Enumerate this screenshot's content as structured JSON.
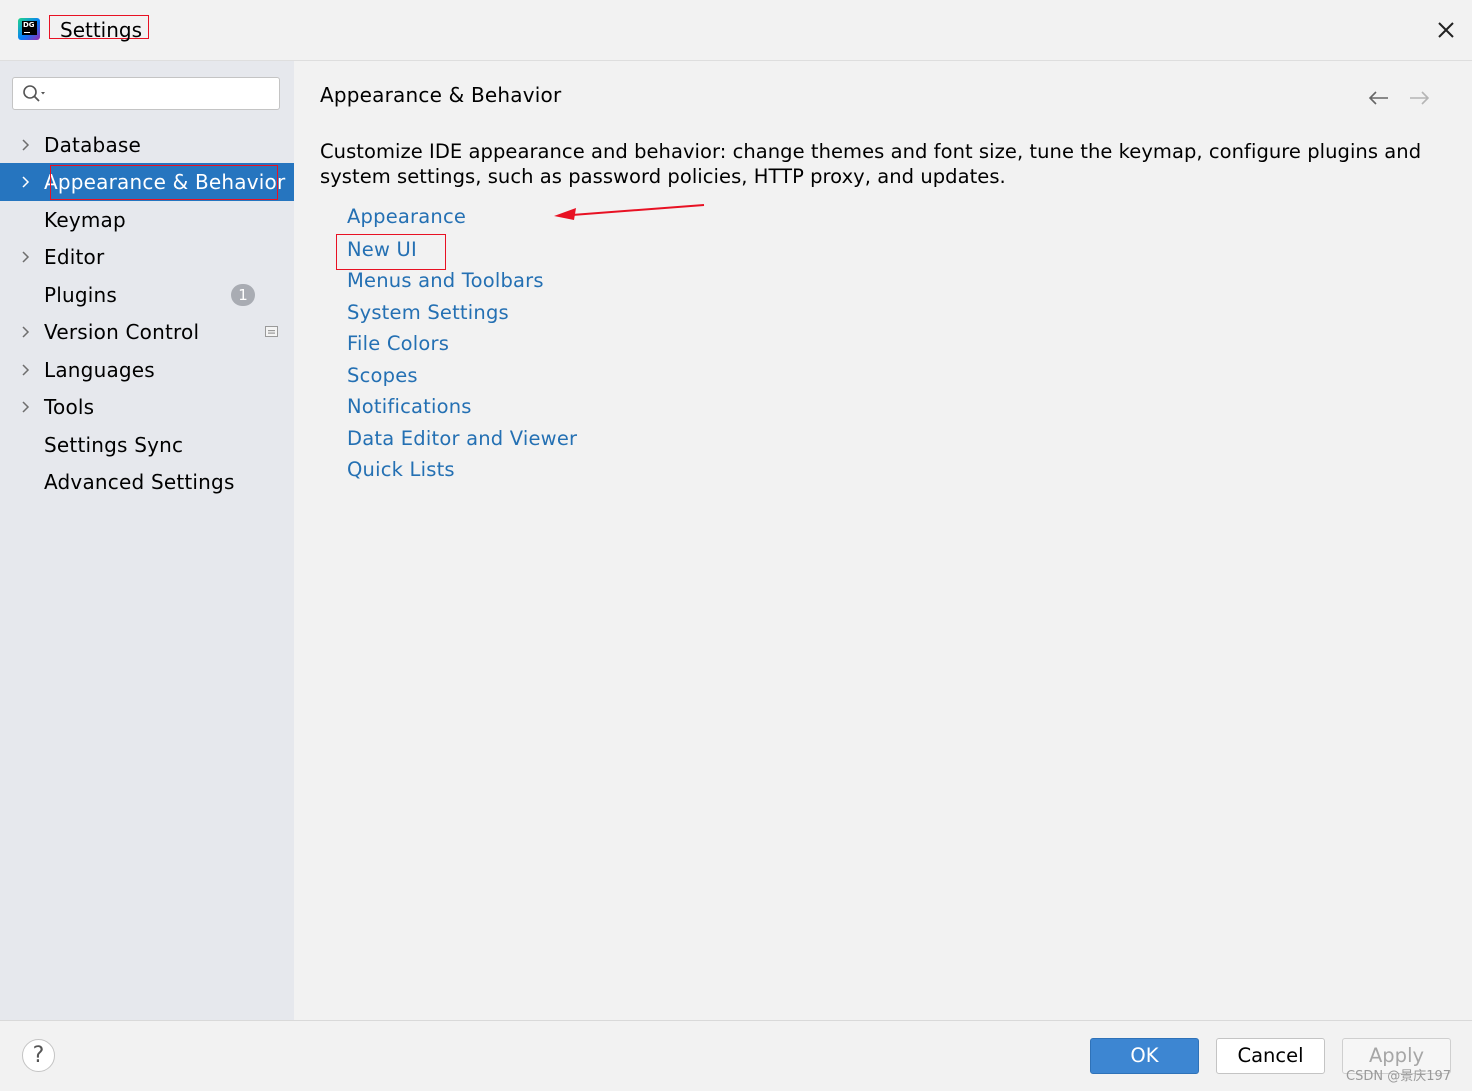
{
  "window": {
    "title": "Settings",
    "icon": "datagrip-app-icon",
    "icon_text": "DG",
    "annotation_color": "#e81123"
  },
  "sidebar": {
    "search": {
      "placeholder": "",
      "value": ""
    },
    "items": [
      {
        "label": "Database",
        "expandable": true,
        "selected": false
      },
      {
        "label": "Appearance & Behavior",
        "expandable": true,
        "selected": true
      },
      {
        "label": "Keymap",
        "expandable": false,
        "selected": false
      },
      {
        "label": "Editor",
        "expandable": true,
        "selected": false
      },
      {
        "label": "Plugins",
        "expandable": false,
        "selected": false,
        "badge": "1"
      },
      {
        "label": "Version Control",
        "expandable": true,
        "selected": false,
        "icon": "project-settings-icon"
      },
      {
        "label": "Languages",
        "expandable": true,
        "selected": false
      },
      {
        "label": "Tools",
        "expandable": true,
        "selected": false
      },
      {
        "label": "Settings Sync",
        "expandable": false,
        "selected": false
      },
      {
        "label": "Advanced Settings",
        "expandable": false,
        "selected": false
      }
    ],
    "selected_color": "#2675bf"
  },
  "content": {
    "title": "Appearance & Behavior",
    "description": "Customize IDE appearance and behavior: change themes and font size, tune the keymap, configure plugins and system settings, such as password policies, HTTP proxy, and updates.",
    "links": [
      "Appearance",
      "New UI",
      "Menus and Toolbars",
      "System Settings",
      "File Colors",
      "Scopes",
      "Notifications",
      "Data Editor and Viewer",
      "Quick Lists"
    ],
    "link_color": "#2470b3"
  },
  "footer": {
    "help_label": "?",
    "ok_label": "OK",
    "cancel_label": "Cancel",
    "apply_label": "Apply",
    "watermark": "CSDN @景庆197"
  }
}
